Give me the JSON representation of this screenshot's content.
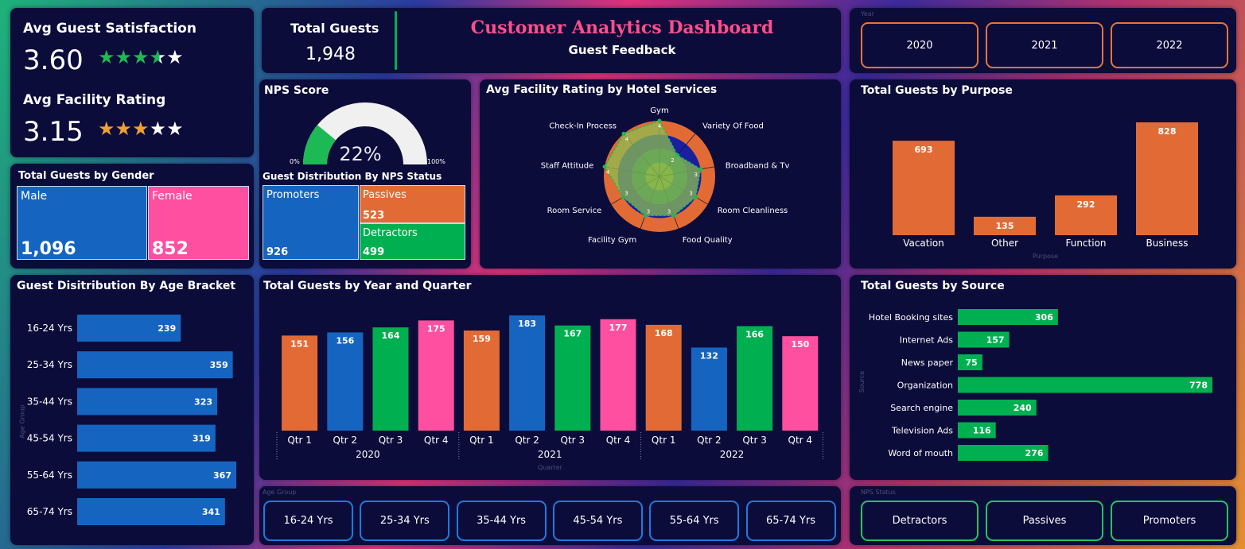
{
  "kpi": {
    "avg_satisfaction_label": "Avg Guest Satisfaction",
    "avg_satisfaction_value": "3.60",
    "avg_satisfaction_stars": 3.6,
    "avg_facility_label": "Avg Facility Rating",
    "avg_facility_value": "3.15",
    "avg_facility_stars": 3.15,
    "star_green": "#1db954",
    "star_orange": "#f0a030"
  },
  "total_guests": {
    "label": "Total Guests",
    "value": "1,948"
  },
  "header": {
    "title": "Customer Analytics Dashboard",
    "subtitle": "Guest Feedback",
    "title_color": "#ff4f8b"
  },
  "year_slicer": {
    "label": "Year",
    "options": [
      "2020",
      "2021",
      "2022"
    ],
    "border_color": "#e8743b"
  },
  "nps": {
    "title": "NPS Score",
    "value": "22%",
    "fraction": 0.22,
    "min_label": "0%",
    "max_label": "100%",
    "fill_color": "#1db954"
  },
  "nps_status": {
    "title": "Guest Distribution By NPS Status",
    "promoters_label": "Promoters",
    "promoters_value": "926",
    "passives_label": "Passives",
    "passives_value": "523",
    "detractors_label": "Detractors",
    "detractors_value": "499"
  },
  "gender": {
    "title": "Total Guests by Gender",
    "male_label": "Male",
    "male_value": "1,096",
    "female_label": "Female",
    "female_value": "852"
  },
  "radar": {
    "title": "Avg Facility Rating by Hotel Services",
    "chart_data": {
      "type": "radar",
      "categories": [
        "Gym",
        "Variety Of Food",
        "Broadband & Tv",
        "Room Cleanliness",
        "Food Quality",
        "Facility Gym",
        "Room Service",
        "Staff Attitude",
        "Check-In Process"
      ],
      "values": [
        4,
        2,
        3,
        3,
        3,
        3,
        3,
        4,
        4
      ],
      "ylim": [
        0,
        4
      ]
    }
  },
  "purpose": {
    "title": "Total Guests by Purpose",
    "axis_label": "Purpose",
    "chart_data": {
      "type": "bar",
      "categories": [
        "Vacation",
        "Other",
        "Function",
        "Business"
      ],
      "values": [
        693,
        135,
        292,
        828
      ],
      "color": "#e26b35"
    }
  },
  "age_bracket": {
    "title": "Guest Disitribution By Age Bracket",
    "axis_label": "Age Group",
    "chart_data": {
      "type": "bar",
      "orientation": "horizontal",
      "categories": [
        "16-24 Yrs",
        "25-34 Yrs",
        "35-44 Yrs",
        "45-54 Yrs",
        "55-64 Yrs",
        "65-74 Yrs"
      ],
      "values": [
        239,
        359,
        323,
        319,
        367,
        341
      ],
      "color": "#1565c0"
    }
  },
  "quarter": {
    "title": "Total Guests by Year and Quarter",
    "axis_label": "Quarter",
    "chart_data": {
      "type": "bar",
      "categories": [
        "Qtr 1",
        "Qtr 2",
        "Qtr 3",
        "Qtr 4",
        "Qtr 1",
        "Qtr 2",
        "Qtr 3",
        "Qtr 4",
        "Qtr 1",
        "Qtr 2",
        "Qtr 3",
        "Qtr 4"
      ],
      "years": [
        "2020",
        "2021",
        "2022"
      ],
      "values": [
        151,
        156,
        164,
        175,
        159,
        183,
        167,
        177,
        168,
        132,
        166,
        150
      ],
      "colors": [
        "#e26b35",
        "#1565c0",
        "#00b050",
        "#ff4fa0"
      ]
    }
  },
  "source": {
    "title": "Total Guests by Source",
    "axis_label": "Source",
    "chart_data": {
      "type": "bar",
      "orientation": "horizontal",
      "categories": [
        "Hotel Booking sites",
        "Internet Ads",
        "News paper",
        "Organization",
        "Search engine",
        "Television Ads",
        "Word of mouth"
      ],
      "values": [
        306,
        157,
        75,
        778,
        240,
        116,
        276
      ],
      "color": "#00b050"
    }
  },
  "age_slicer": {
    "label": "Age Group",
    "options": [
      "16-24 Yrs",
      "25-34 Yrs",
      "35-44 Yrs",
      "45-54 Yrs",
      "55-64 Yrs",
      "65-74 Yrs"
    ],
    "border_color": "#1e7be0"
  },
  "nps_slicer": {
    "label": "NPS Status",
    "options": [
      "Detractors",
      "Passives",
      "Promoters"
    ],
    "border_color": "#22c55e"
  }
}
